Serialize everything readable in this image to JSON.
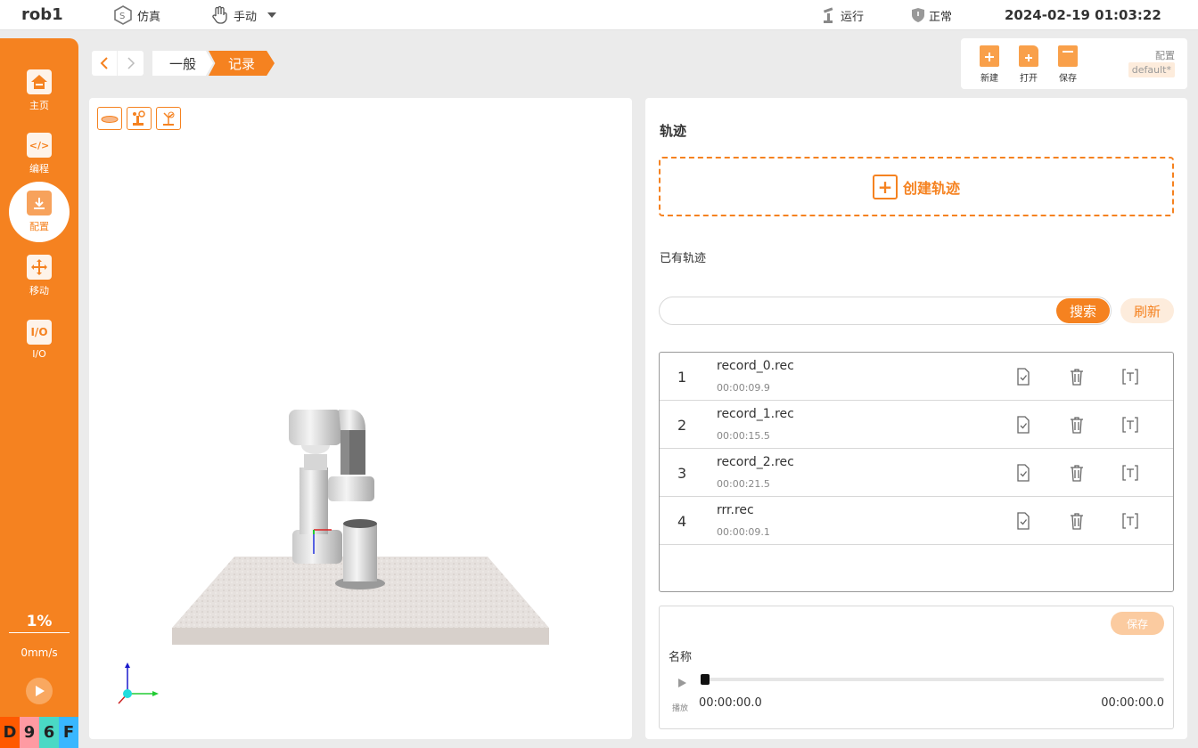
{
  "topbar": {
    "robot_name": "rob1",
    "sim_label": "仿真",
    "mode_label": "手动",
    "run_label": "运行",
    "status_label": "正常",
    "datetime": "2024-02-19 01:03:22"
  },
  "sidebar": {
    "items": [
      {
        "label": "主页",
        "icon": "home-icon"
      },
      {
        "label": "编程",
        "icon": "code-icon"
      },
      {
        "label": "配置",
        "icon": "config-icon"
      },
      {
        "label": "移动",
        "icon": "move-icon"
      },
      {
        "label": "I/O",
        "icon": "io-icon"
      }
    ],
    "io_icon_text": "I/O",
    "code_icon_text": "</>",
    "speed_percent": "1%",
    "speed_value": "0mm/s",
    "debug": [
      {
        "char": "D",
        "color": "#ff5a00"
      },
      {
        "char": "9",
        "color": "#ff9aa2"
      },
      {
        "char": "6",
        "color": "#4ad9c5"
      },
      {
        "char": "F",
        "color": "#39b7ff"
      }
    ]
  },
  "breadcrumb": {
    "items": [
      "一般",
      "记录"
    ]
  },
  "file_toolbar": {
    "new_label": "新建",
    "open_label": "打开",
    "save_label": "保存",
    "config_label": "配置",
    "config_value": "default*"
  },
  "panel": {
    "title": "轨迹",
    "create_label": "创建轨迹",
    "existing_label": "已有轨迹",
    "search_placeholder": "",
    "search_label": "搜索",
    "refresh_label": "刷新",
    "records": [
      {
        "index": "1",
        "name": "record_0.rec",
        "duration": "00:00:09.9"
      },
      {
        "index": "2",
        "name": "record_1.rec",
        "duration": "00:00:15.5"
      },
      {
        "index": "3",
        "name": "record_2.rec",
        "duration": "00:00:21.5"
      },
      {
        "index": "4",
        "name": "rrr.rec",
        "duration": "00:00:09.1"
      }
    ]
  },
  "player": {
    "save_label": "保存",
    "name_label": "名称",
    "play_label": "播放",
    "time_start": "00:00:00.0",
    "time_end": "00:00:00.0",
    "progress": 0
  },
  "colors": {
    "accent": "#f58220",
    "accent_light": "#fdecdc"
  }
}
